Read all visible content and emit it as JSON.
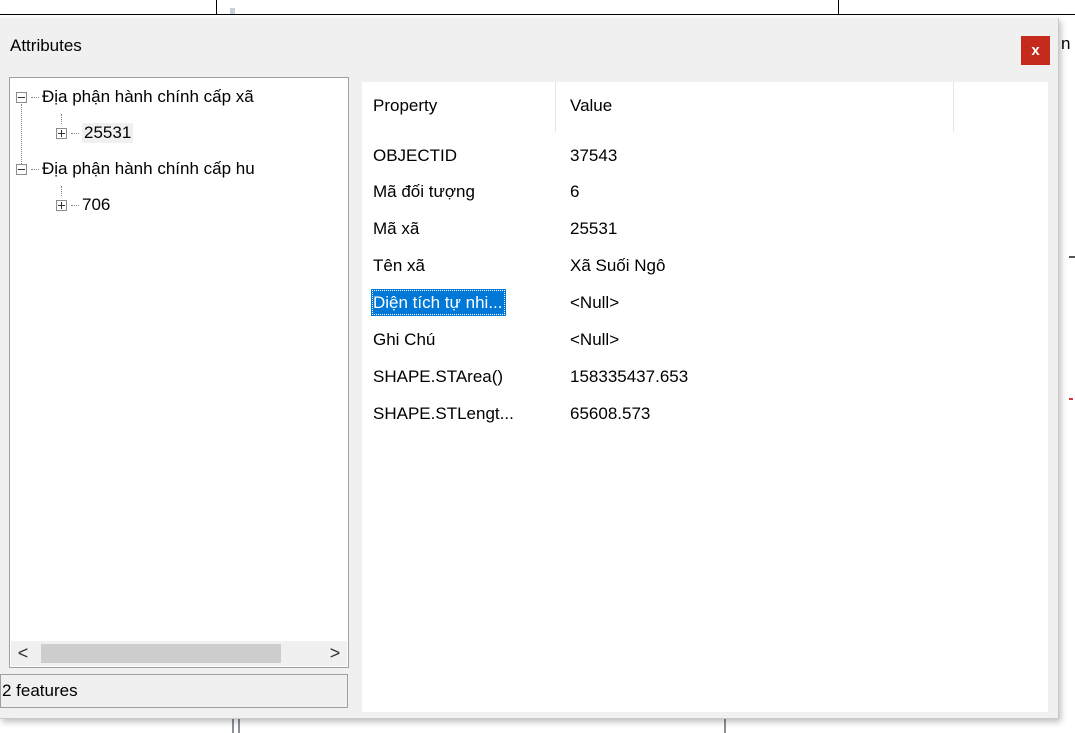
{
  "background": {
    "right_fragment_text": "n"
  },
  "dialog": {
    "title": "Attributes",
    "close_label": "x",
    "colors": {
      "close_button": "#c42b1c",
      "selection": "#0078d7"
    }
  },
  "tree": {
    "nodes": [
      {
        "label": "Địa phận hành chính cấp xã",
        "expanded": true
      },
      {
        "label": "25531",
        "expanded": false
      },
      {
        "label": "Địa phận hành chính cấp hu",
        "expanded": true
      },
      {
        "label": "706",
        "expanded": false
      }
    ],
    "scroll_left": "<",
    "scroll_right": ">"
  },
  "status": {
    "text": "2 features"
  },
  "properties": {
    "header": {
      "property": "Property",
      "value": "Value"
    },
    "rows": [
      {
        "key": "OBJECTID",
        "value": "37543"
      },
      {
        "key": "Mã đối tượng",
        "value": "6"
      },
      {
        "key": "Mã xã",
        "value": "25531"
      },
      {
        "key": "Tên xã",
        "value": "Xã Suối Ngô"
      },
      {
        "key": "Diện tích tự nhi...",
        "value": "<Null>"
      },
      {
        "key": "Ghi Chú",
        "value": "<Null>"
      },
      {
        "key": "SHAPE.STArea()",
        "value": "158335437.653"
      },
      {
        "key": "SHAPE.STLengt...",
        "value": "65608.573"
      }
    ]
  }
}
